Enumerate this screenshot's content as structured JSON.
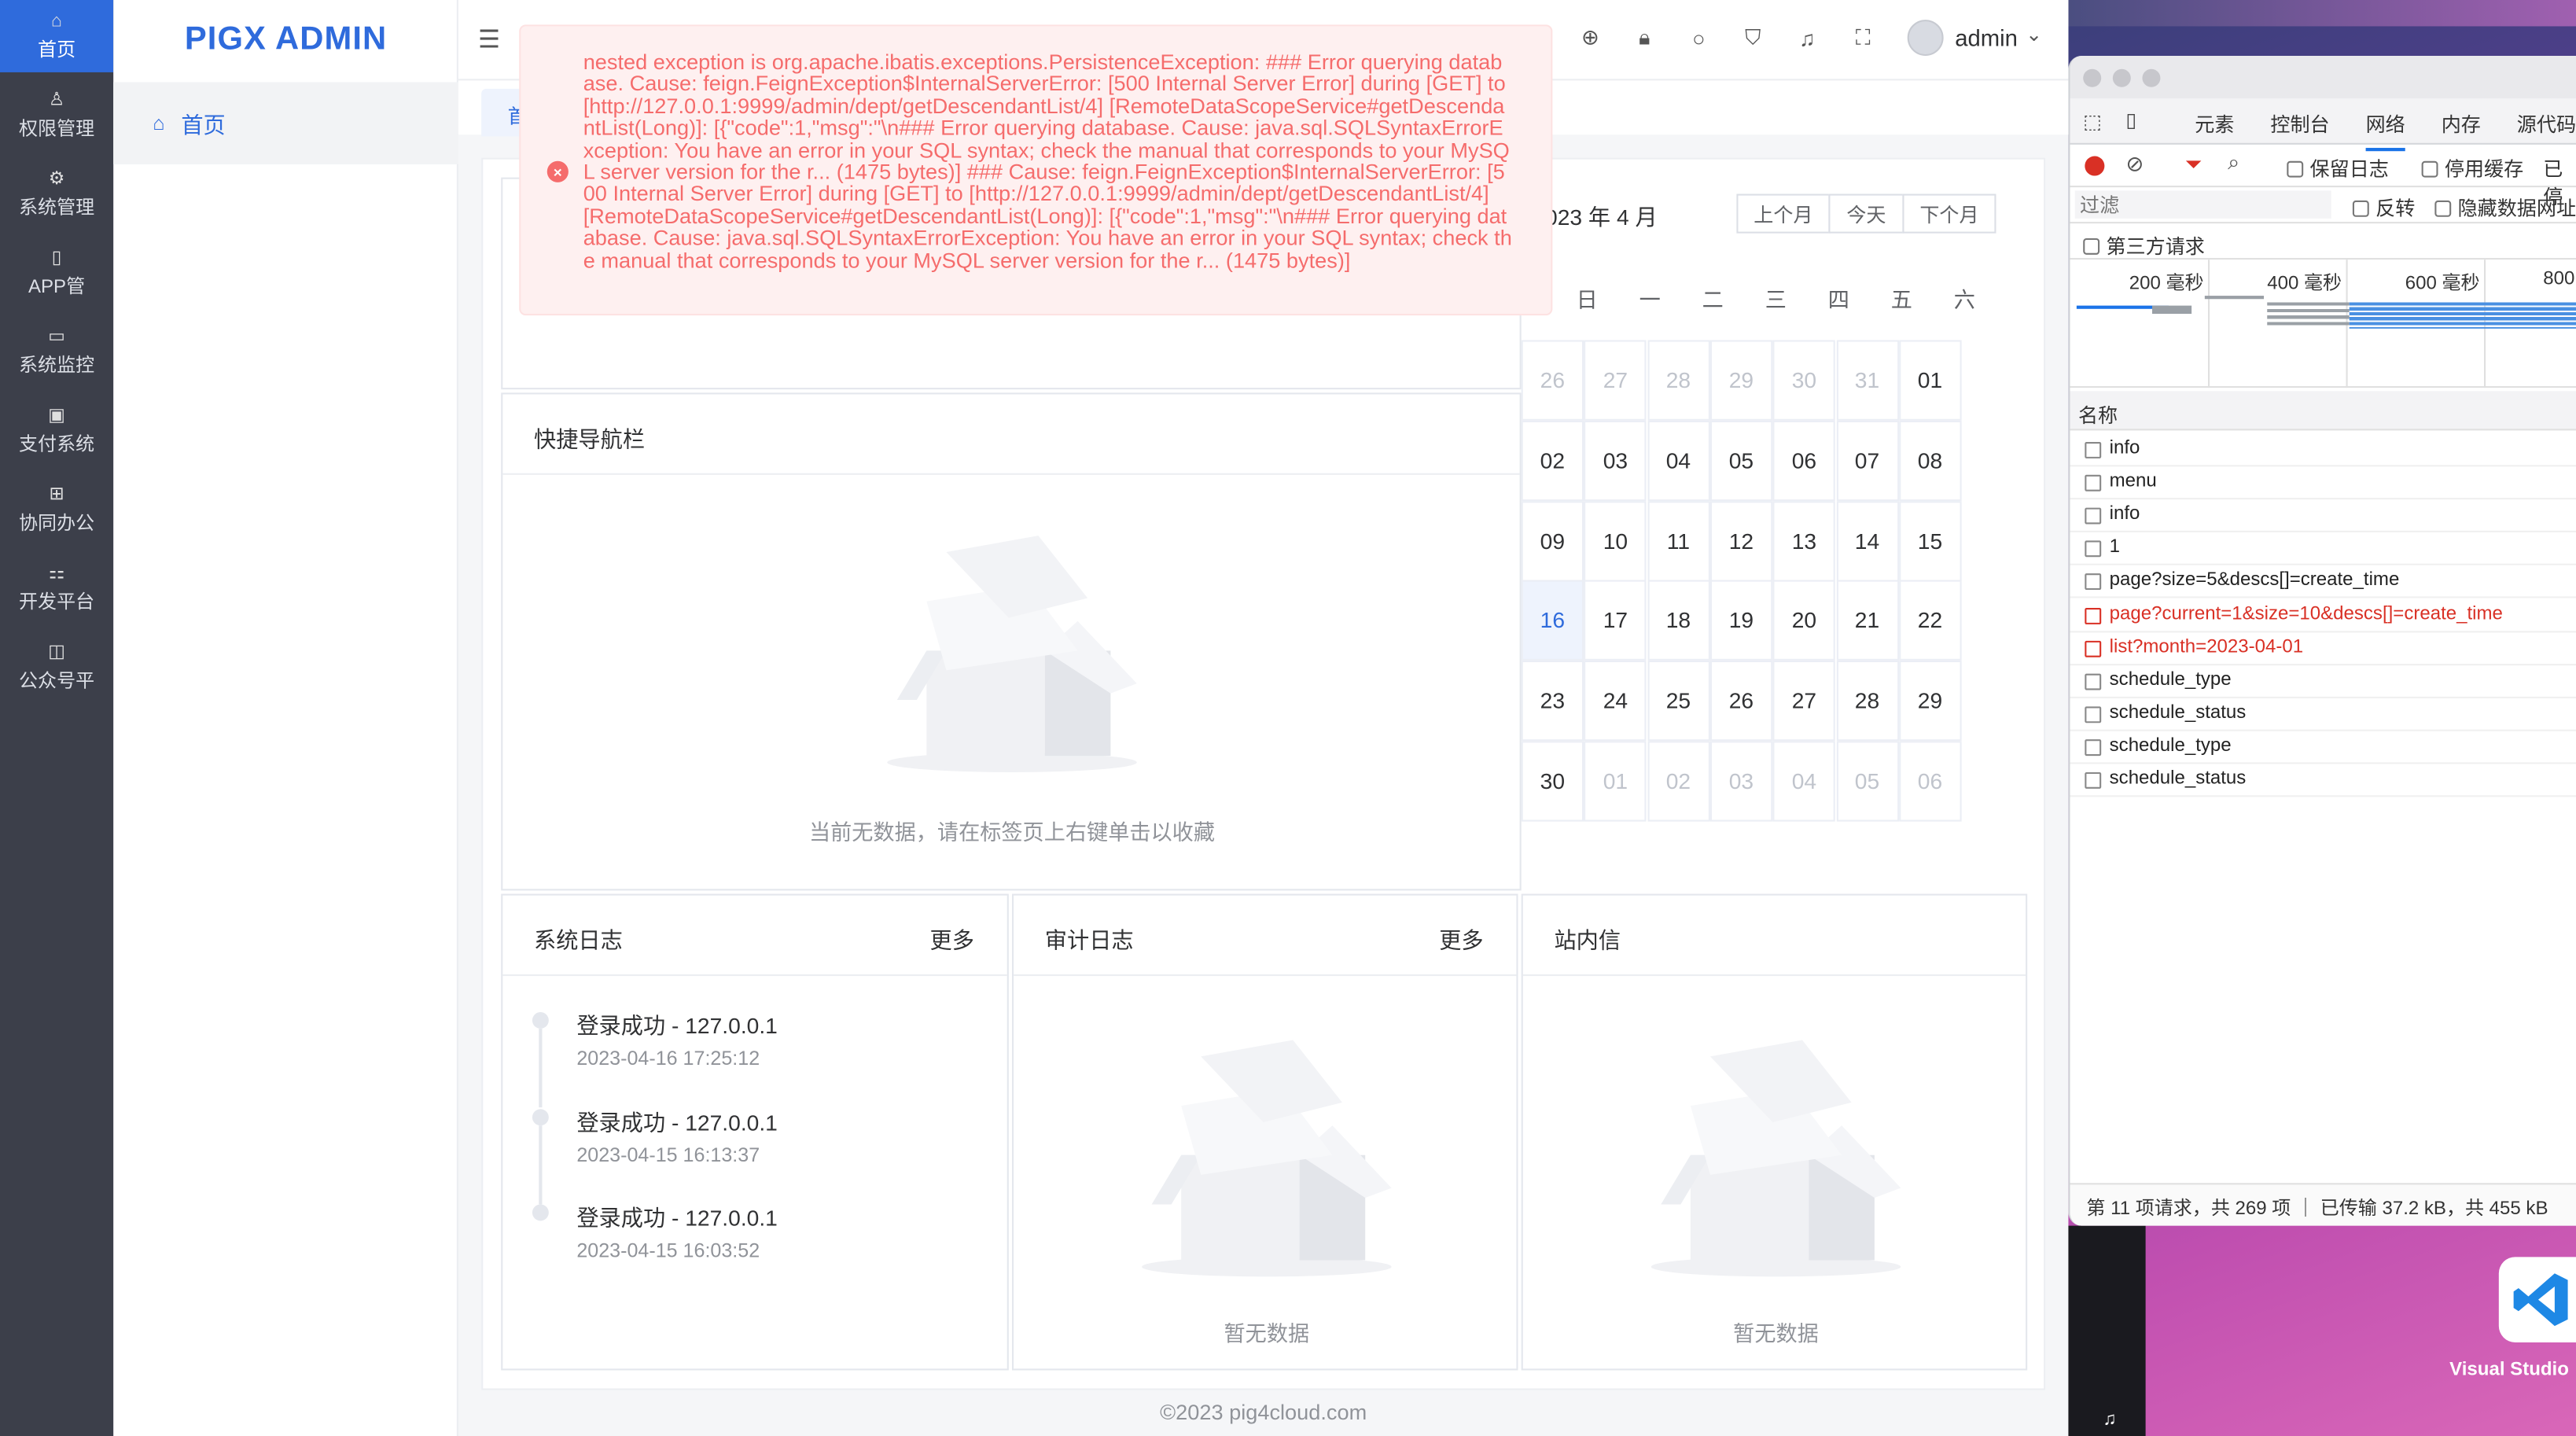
{
  "nav": {
    "items": [
      {
        "label": "首页",
        "icon": "home-icon",
        "glyph": "⌂"
      },
      {
        "label": "权限管理",
        "icon": "user-icon",
        "glyph": "♙"
      },
      {
        "label": "系统管理",
        "icon": "settings-icon",
        "glyph": "⚙"
      },
      {
        "label": "APP管",
        "icon": "phone-icon",
        "glyph": "▯"
      },
      {
        "label": "系统监控",
        "icon": "monitor-icon",
        "glyph": "▭"
      },
      {
        "label": "支付系统",
        "icon": "payment-icon",
        "glyph": "▣"
      },
      {
        "label": "协同办公",
        "icon": "office-icon",
        "glyph": "⊞"
      },
      {
        "label": "开发平台",
        "icon": "dev-platform-icon",
        "glyph": "⚏"
      },
      {
        "label": "公众号平",
        "icon": "wechat-icon",
        "glyph": "◫"
      }
    ]
  },
  "app": {
    "title": "PIGX ADMIN"
  },
  "submenu": {
    "home": "首页"
  },
  "header": {
    "username": "admin"
  },
  "tabs": {
    "home": "首"
  },
  "error": {
    "message": "nested exception is org.apache.ibatis.exceptions.PersistenceException: ### Error querying database. Cause: feign.FeignException$InternalServerError: [500 Internal Server Error] during [GET] to [http://127.0.0.1:9999/admin/dept/getDescendantList/4] [RemoteDataScopeService#getDescendantList(Long)]: [{\"code\":1,\"msg\":\"\\n### Error querying database. Cause: java.sql.SQLSyntaxErrorException: You have an error in your SQL syntax; check the manual that corresponds to your MySQL server version for the r... (1475 bytes)] ### Cause: feign.FeignException$InternalServerError: [500 Internal Server Error] during [GET] to [http://127.0.0.1:9999/admin/dept/getDescendantList/4] [RemoteDataScopeService#getDescendantList(Long)]: [{\"code\":1,\"msg\":\"\\n### Error querying database. Cause: java.sql.SQLSyntaxErrorException: You have an error in your SQL syntax; check the manual that corresponds to your MySQL server version for the r... (1475 bytes)]"
  },
  "quicknav": {
    "title": "快捷导航栏",
    "empty": "当前无数据，请在标签页上右键单击以收藏"
  },
  "calendar": {
    "title": "2023 年 4 月",
    "prev": "上个月",
    "today": "今天",
    "next": "下个月",
    "weekdays": [
      "日",
      "一",
      "二",
      "三",
      "四",
      "五",
      "六"
    ],
    "today_day": "16",
    "days": [
      [
        "26",
        "27",
        "28",
        "29",
        "30",
        "31",
        "01"
      ],
      [
        "02",
        "03",
        "04",
        "05",
        "06",
        "07",
        "08"
      ],
      [
        "09",
        "10",
        "11",
        "12",
        "13",
        "14",
        "15"
      ],
      [
        "16",
        "17",
        "18",
        "19",
        "20",
        "21",
        "22"
      ],
      [
        "23",
        "24",
        "25",
        "26",
        "27",
        "28",
        "29"
      ],
      [
        "30",
        "01",
        "02",
        "03",
        "04",
        "05",
        "06"
      ]
    ],
    "other_month": [
      [
        0,
        0
      ],
      [
        0,
        1
      ],
      [
        0,
        2
      ],
      [
        0,
        3
      ],
      [
        0,
        4
      ],
      [
        0,
        5
      ],
      [
        5,
        1
      ],
      [
        5,
        2
      ],
      [
        5,
        3
      ],
      [
        5,
        4
      ],
      [
        5,
        5
      ],
      [
        5,
        6
      ]
    ]
  },
  "syslog": {
    "title": "系统日志",
    "more": "更多",
    "entries": [
      {
        "title": "登录成功 - 127.0.0.1",
        "time": "2023-04-16 17:25:12"
      },
      {
        "title": "登录成功 - 127.0.0.1",
        "time": "2023-04-15 16:13:37"
      },
      {
        "title": "登录成功 - 127.0.0.1",
        "time": "2023-04-15 16:03:52"
      }
    ]
  },
  "audit": {
    "title": "审计日志",
    "more": "更多",
    "empty": "暂无数据"
  },
  "inbox": {
    "title": "站内信",
    "empty": "暂无数据"
  },
  "footer": {
    "text": "©2023 pig4cloud.com"
  },
  "devtools": {
    "tabs": [
      "元素",
      "控制台",
      "网络",
      "内存",
      "源代码"
    ],
    "selected_tab": "网络",
    "preserve_log": "保留日志",
    "disable_cache": "停用缓存",
    "disable_trunc": "已停",
    "filter_placeholder": "过滤",
    "invert": "反转",
    "hide_data": "隐藏数据网址",
    "third_party": "第三方请求",
    "timeline_ticks": [
      "200 毫秒",
      "400 毫秒",
      "600 毫秒",
      "800"
    ],
    "name_header": "名称",
    "requests": [
      {
        "name": "info",
        "error": false
      },
      {
        "name": "menu",
        "error": false
      },
      {
        "name": "info",
        "error": false
      },
      {
        "name": "1",
        "error": false
      },
      {
        "name": "page?size=5&descs[]=create_time",
        "error": false
      },
      {
        "name": "page?current=1&size=10&descs[]=create_time",
        "error": true
      },
      {
        "name": "list?month=2023-04-01",
        "error": true
      },
      {
        "name": "schedule_type",
        "error": false
      },
      {
        "name": "schedule_status",
        "error": false
      },
      {
        "name": "schedule_type",
        "error": false
      },
      {
        "name": "schedule_status",
        "error": false
      }
    ],
    "status": "第 11 项请求，共 269 项 ｜ 已传输 37.2 kB，共 455 kB"
  },
  "dock": {
    "vscode_label": "Visual Studio"
  },
  "colors": {
    "primary": "#2f6bdc",
    "error": "#f56c6c",
    "nav_bg": "#3c3f4a"
  }
}
